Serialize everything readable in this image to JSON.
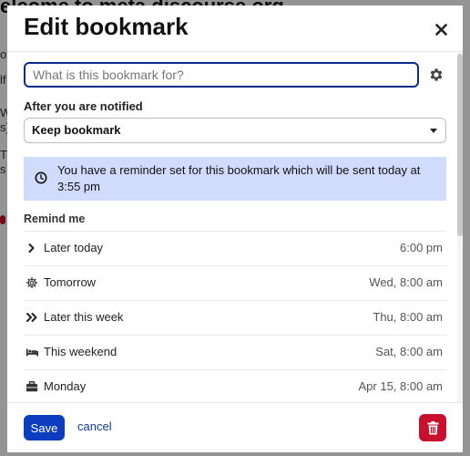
{
  "background": {
    "title": "elcome to meta.discourse.org",
    "lines": [
      "o",
      "lf",
      "W",
      "s),",
      "T",
      "s"
    ]
  },
  "modal": {
    "title": "Edit bookmark",
    "name_input": {
      "value": "",
      "placeholder": "What is this bookmark for?"
    },
    "after_notified_label": "After you are notified",
    "after_notified_selected": "Keep bookmark",
    "alert_text": "You have a reminder set for this bookmark which will be sent today at 3:55 pm",
    "remind_me_label": "Remind me",
    "options": [
      {
        "icon": "angle-right-icon",
        "label": "Later today",
        "time": "6:00 pm"
      },
      {
        "icon": "gear-icon",
        "label": "Tomorrow",
        "time": "Wed, 8:00 am"
      },
      {
        "icon": "double-angle-right-icon",
        "label": "Later this week",
        "time": "Thu, 8:00 am"
      },
      {
        "icon": "bed-icon",
        "label": "This weekend",
        "time": "Sat, 8:00 am"
      },
      {
        "icon": "briefcase-icon",
        "label": "Monday",
        "time": "Apr 15, 8:00 am"
      }
    ],
    "save_label": "Save",
    "cancel_label": "cancel"
  },
  "colors": {
    "primary": "#0c3cbf",
    "danger": "#c8102e",
    "alert_bg": "#d1dcfd",
    "input_focus": "#0a2c8c"
  }
}
